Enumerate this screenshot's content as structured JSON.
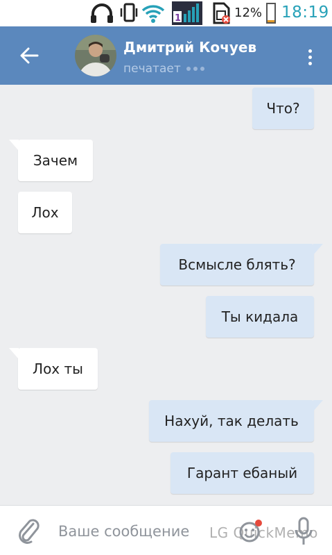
{
  "status_bar": {
    "battery_text": "12%",
    "battery_level": 0.12,
    "time": "18:19",
    "icons": [
      "headphones-icon",
      "vibrate-icon",
      "wifi-icon",
      "signal-icon",
      "sim-icon",
      "battery-icon"
    ],
    "time_color": "#27a1b8"
  },
  "header": {
    "contact_name": "Дмитрий Кочуев",
    "status": "печатает",
    "icons": [
      "back-arrow-icon",
      "avatar",
      "more-vert-icon"
    ],
    "color": "#5b88bd"
  },
  "messages": [
    {
      "dir": "out",
      "text": "Что?",
      "tail": false
    },
    {
      "dir": "in",
      "text": "Зачем",
      "tail": true
    },
    {
      "dir": "in",
      "text": "Лох",
      "tail": false
    },
    {
      "dir": "out",
      "text": "Всмысле блять?",
      "tail": true
    },
    {
      "dir": "out",
      "text": "Ты кидала",
      "tail": false
    },
    {
      "dir": "in",
      "text": "Лох ты",
      "tail": true
    },
    {
      "dir": "out",
      "text": "Нахуй, так делать",
      "tail": true
    },
    {
      "dir": "out",
      "text": "Гарант ебаный",
      "tail": false
    }
  ],
  "colors": {
    "incoming_bubble": "#ffffff",
    "outgoing_bubble": "#d9e6f5",
    "chat_background": "#edeef0"
  },
  "input": {
    "placeholder": "Ваше сообщение",
    "value": "",
    "watermark": "LG QuickMemo",
    "icons": [
      "paperclip-icon",
      "emoji-icon",
      "microphone-icon"
    ]
  }
}
